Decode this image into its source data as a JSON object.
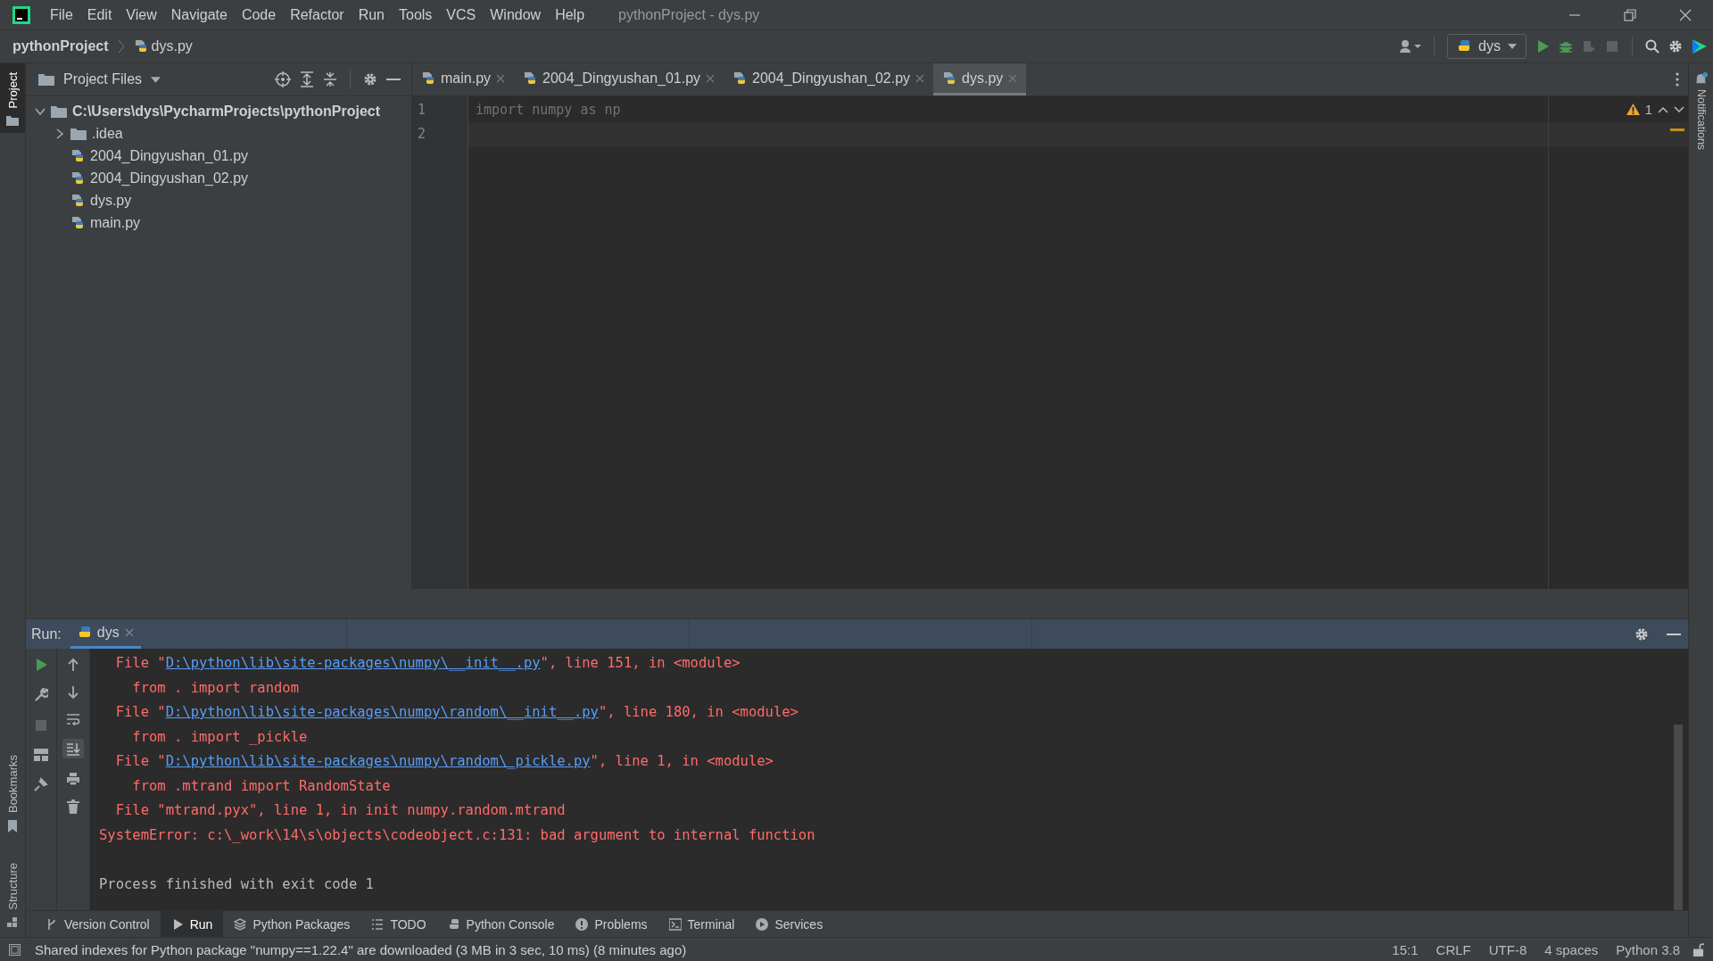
{
  "menu": [
    "File",
    "Edit",
    "View",
    "Navigate",
    "Code",
    "Refactor",
    "Run",
    "Tools",
    "VCS",
    "Window",
    "Help"
  ],
  "window": {
    "title": "pythonProject - dys.py"
  },
  "breadcrumb": [
    "pythonProject",
    "dys.py"
  ],
  "toolbar": {
    "run_config": "dys"
  },
  "left_strip": [
    {
      "label": "Project",
      "selected": true
    },
    {
      "label": "Bookmarks",
      "selected": false
    },
    {
      "label": "Structure",
      "selected": false
    }
  ],
  "right_strip": [
    {
      "label": "Notifications"
    }
  ],
  "project": {
    "title": "Project Files",
    "tree": [
      {
        "label": "C:\\Users\\dys\\PycharmProjects\\pythonProject",
        "kind": "folder",
        "expanded": true,
        "children": [
          {
            "label": ".idea",
            "kind": "folder",
            "expanded": false
          },
          {
            "label": "2004_Dingyushan_01.py",
            "kind": "python"
          },
          {
            "label": "2004_Dingyushan_02.py",
            "kind": "python"
          },
          {
            "label": "dys.py",
            "kind": "python"
          },
          {
            "label": "main.py",
            "kind": "python"
          }
        ]
      }
    ]
  },
  "editor_tabs": [
    {
      "label": "main.py",
      "selected": false
    },
    {
      "label": "2004_Dingyushan_01.py",
      "selected": false
    },
    {
      "label": "2004_Dingyushan_02.py",
      "selected": false
    },
    {
      "label": "dys.py",
      "selected": true
    }
  ],
  "editor": {
    "lines": [
      {
        "number": "1",
        "text": "import numpy as np",
        "unused": true
      },
      {
        "number": "2"
      }
    ],
    "warnings": "1"
  },
  "run": {
    "label": "Run:",
    "tabs": [
      {
        "label": "dys",
        "selected": true
      }
    ],
    "console": [
      {
        "kind": "error",
        "segments": [
          {
            "text": "  File \""
          },
          {
            "text": "D:\\python\\lib\\site-packages\\numpy\\__init__.py",
            "link": true
          },
          {
            "text": "\", line 151, in <module>"
          }
        ]
      },
      {
        "kind": "error",
        "segments": [
          {
            "text": "    from . import random"
          }
        ]
      },
      {
        "kind": "error",
        "segments": [
          {
            "text": "  File \""
          },
          {
            "text": "D:\\python\\lib\\site-packages\\numpy\\random\\__init__.py",
            "link": true
          },
          {
            "text": "\", line 180, in <module>"
          }
        ]
      },
      {
        "kind": "error",
        "segments": [
          {
            "text": "    from . import _pickle"
          }
        ]
      },
      {
        "kind": "error",
        "segments": [
          {
            "text": "  File \""
          },
          {
            "text": "D:\\python\\lib\\site-packages\\numpy\\random\\_pickle.py",
            "link": true
          },
          {
            "text": "\", line 1, in <module>"
          }
        ]
      },
      {
        "kind": "error",
        "segments": [
          {
            "text": "    from .mtrand import RandomState"
          }
        ]
      },
      {
        "kind": "error",
        "segments": [
          {
            "text": "  File \"mtrand.pyx\", line 1, in init numpy.random.mtrand"
          }
        ]
      },
      {
        "kind": "error",
        "segments": [
          {
            "text": "SystemError: c:\\_work\\14\\s\\objects\\codeobject.c:131: bad argument to internal function"
          }
        ]
      },
      {
        "kind": "blank"
      },
      {
        "kind": "plain",
        "segments": [
          {
            "text": "Process finished with exit code 1"
          }
        ]
      }
    ]
  },
  "bottom_tabs": [
    {
      "label": "Version Control",
      "kind": "branch",
      "selected": false
    },
    {
      "label": "Run",
      "kind": "play",
      "selected": true
    },
    {
      "label": "Python Packages",
      "kind": "layers",
      "selected": false
    },
    {
      "label": "TODO",
      "kind": "list",
      "selected": false
    },
    {
      "label": "Python Console",
      "kind": "python",
      "selected": false
    },
    {
      "label": "Problems",
      "kind": "alert",
      "selected": false
    },
    {
      "label": "Terminal",
      "kind": "terminal",
      "selected": false
    },
    {
      "label": "Services",
      "kind": "services",
      "selected": false
    }
  ],
  "status_bar": {
    "message": "Shared indexes for Python package \"numpy==1.22.4\" are downloaded (3 MB in 3 sec, 10 ms) (8 minutes ago)",
    "items": [
      "15:1",
      "CRLF",
      "UTF-8",
      "4 spaces",
      "Python 3.8"
    ]
  }
}
